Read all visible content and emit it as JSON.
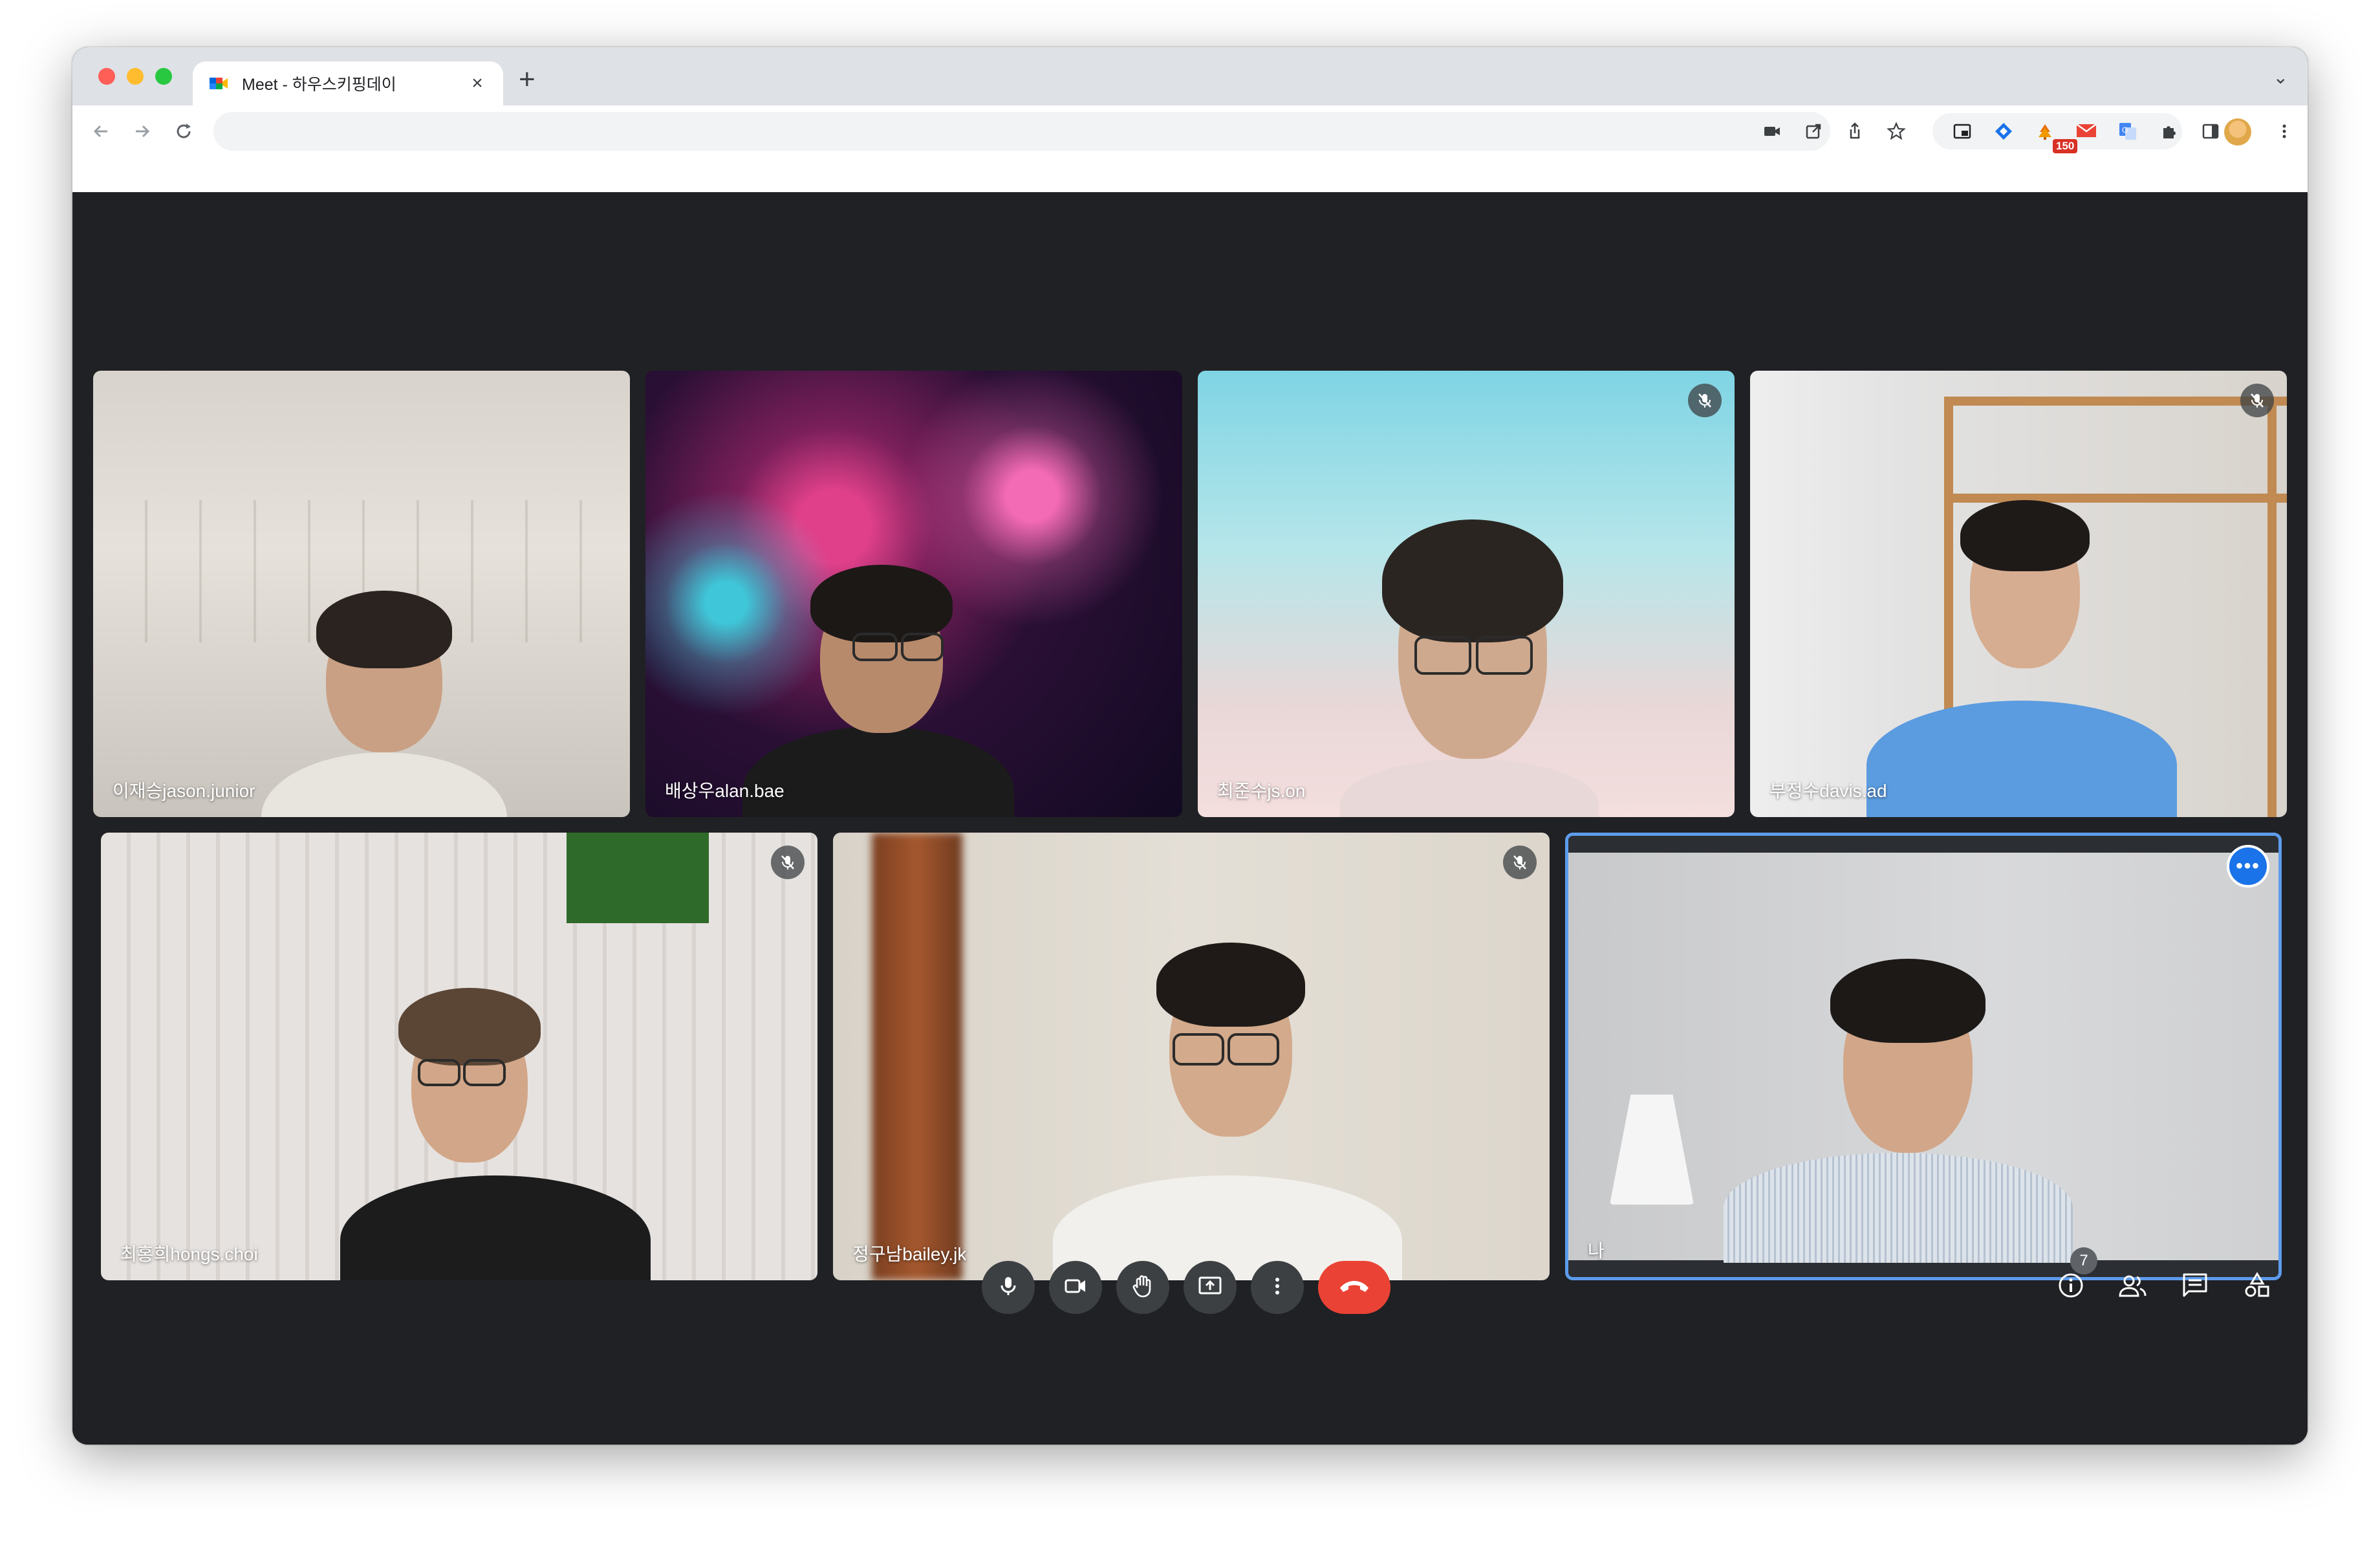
{
  "browser": {
    "tab_title": "Meet - 하우스키핑데이",
    "tab_close": "×",
    "new_tab": "+",
    "tab_menu": "⌄",
    "mail_badge": "150"
  },
  "meeting": {
    "participants": [
      {
        "name": "이재승jason.junior",
        "muted": false
      },
      {
        "name": "배상우alan.bae",
        "muted": false
      },
      {
        "name": "최준수js.on",
        "muted": true
      },
      {
        "name": "부정수davis.ad",
        "muted": true
      },
      {
        "name": "최홍희hongs.choi",
        "muted": true
      },
      {
        "name": "정구남bailey.jk",
        "muted": true
      },
      {
        "name": "나",
        "muted": false
      }
    ],
    "self_more": "•••",
    "people_count": "7"
  },
  "colors": {
    "stage_bg": "#202124",
    "button_bg": "#3c4043",
    "end_call": "#ea4335",
    "self_border": "#5d9cec",
    "accent_blue": "#1a73e8"
  },
  "icons": {
    "controls": [
      "mic-icon",
      "camera-icon",
      "raise-hand-icon",
      "present-icon",
      "more-options-icon",
      "end-call-icon"
    ],
    "right_panel": [
      "info-icon",
      "people-icon",
      "chat-icon",
      "activities-icon",
      "host-controls-icon"
    ]
  }
}
